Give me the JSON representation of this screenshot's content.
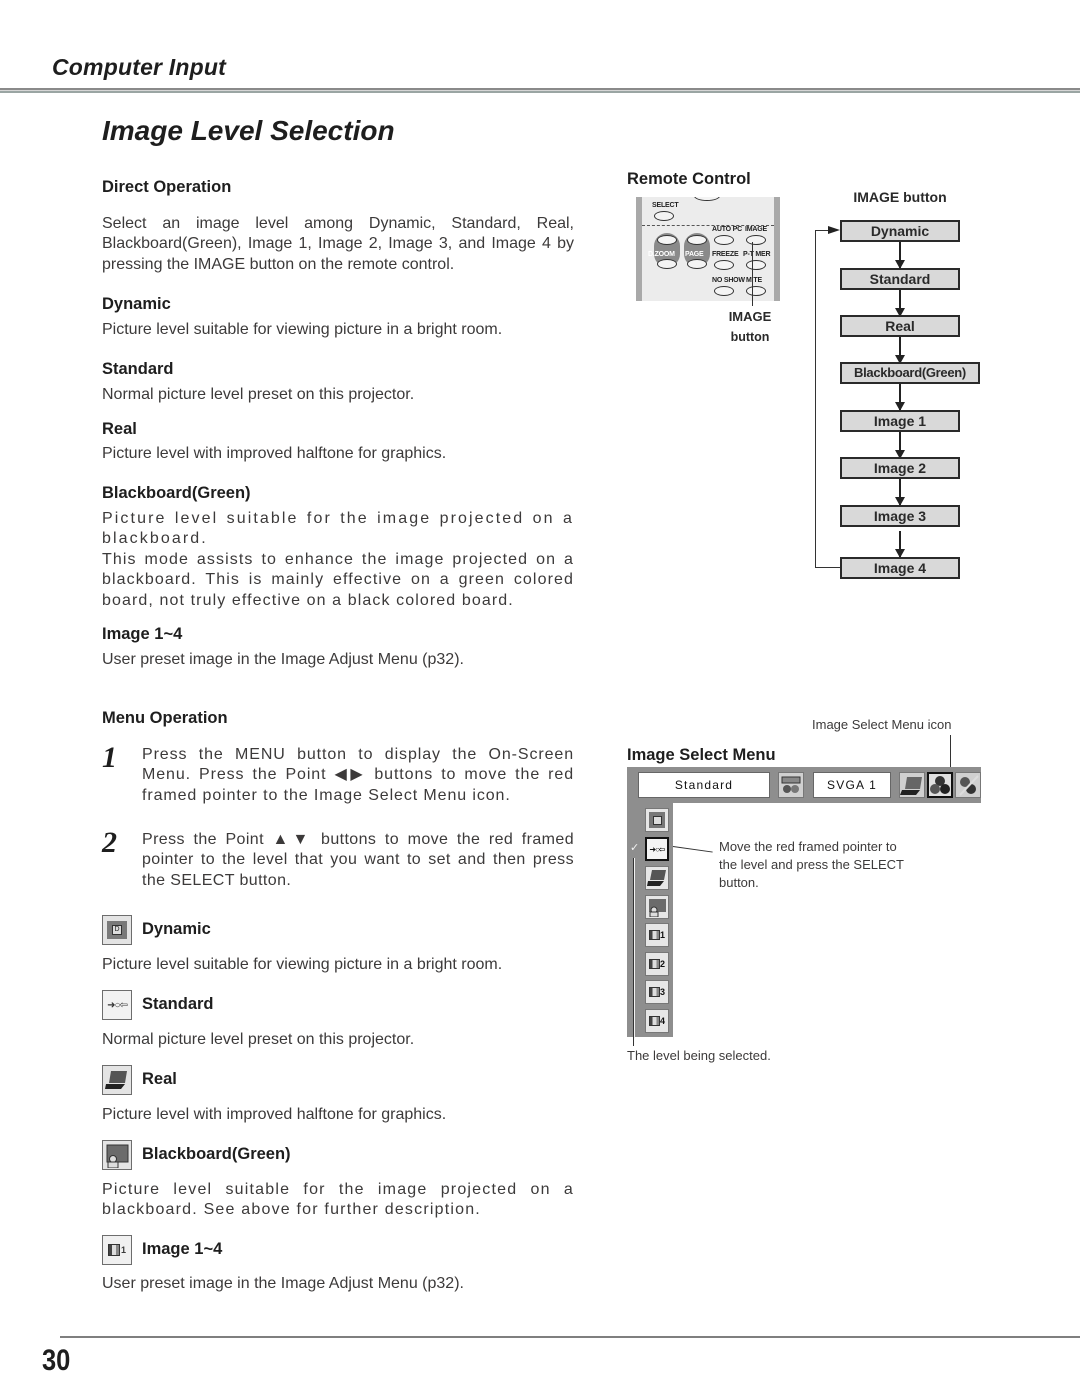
{
  "header": {
    "section": "Computer Input",
    "title": "Image Level Selection"
  },
  "direct": {
    "heading": "Direct Operation",
    "intro": "Select an image level among Dynamic, Standard, Real, Blackboard(Green), Image 1, Image 2, Image 3, and Image 4 by pressing the IMAGE button on the remote control.",
    "items": [
      {
        "title": "Dynamic",
        "desc": "Picture level suitable for viewing picture in a bright room."
      },
      {
        "title": "Standard",
        "desc": "Normal picture level preset on this projector."
      },
      {
        "title": "Real",
        "desc": "Picture level with improved halftone for graphics."
      },
      {
        "title": "Blackboard(Green)",
        "desc": "Picture level suitable for the image projected on a blackboard.",
        "desc2": "This mode assists to enhance the image projected on a blackboard.  This is mainly effective on a green colored board, not truly effective on a black colored board."
      },
      {
        "title": "Image 1~4",
        "desc": "User preset image in the Image Adjust Menu (p32)."
      }
    ]
  },
  "menu_op": {
    "heading": "Menu Operation",
    "steps": [
      {
        "num": "1",
        "text": "Press the MENU button to display the On-Screen Menu.  Press the Point ◀▶ buttons to move the red framed pointer to the Image Select Menu icon."
      },
      {
        "num": "2",
        "text": "Press the Point ▲▼ buttons to move the red framed pointer to the level that you want to set and then press the SELECT button."
      }
    ],
    "items": [
      {
        "icon": "dynamic-level-icon",
        "title": "Dynamic",
        "desc": "Picture level suitable for viewing picture in a bright room."
      },
      {
        "icon": "standard-level-icon",
        "title": "Standard",
        "desc": "Normal picture level preset on this projector."
      },
      {
        "icon": "real-level-icon",
        "title": "Real",
        "desc": "Picture level with improved halftone for graphics."
      },
      {
        "icon": "blackboard-level-icon",
        "title": "Blackboard(Green)",
        "desc": "Picture level suitable for the image projected on a blackboard.   See above for further description."
      },
      {
        "icon": "image-preset-level-icon",
        "title": "Image 1~4",
        "desc": "User preset image in the Image Adjust Menu (p32)."
      }
    ]
  },
  "remote": {
    "heading": "Remote Control",
    "labels": {
      "select": "SELECT",
      "autopc": "AUTO PC",
      "image": "IMAGE",
      "dzoom": "D.ZOOM",
      "page": "PAGE",
      "freeze": "FREEZE",
      "ptimer": "P-T  MER",
      "noshow": "NO SHOW",
      "mute": "M  TE"
    },
    "callout_line1": "IMAGE",
    "callout_line2": "button"
  },
  "flow": {
    "heading": "IMAGE button",
    "steps": [
      "Dynamic",
      "Standard",
      "Real",
      "Blackboard(Green)",
      "Image 1",
      "Image 2",
      "Image 3",
      "Image 4"
    ]
  },
  "image_menu": {
    "heading": "Image Select Menu",
    "icon_callout": "Image Select Menu icon",
    "current_level": "Standard",
    "signal": "SVGA 1",
    "side_labels": [
      "",
      "",
      "",
      "",
      "1",
      "2",
      "3",
      "4"
    ],
    "pointer_callout": "Move the red framed pointer to the level and press the SELECT button.",
    "selected_callout": "The level being selected."
  },
  "footer": {
    "page_number": "30"
  }
}
